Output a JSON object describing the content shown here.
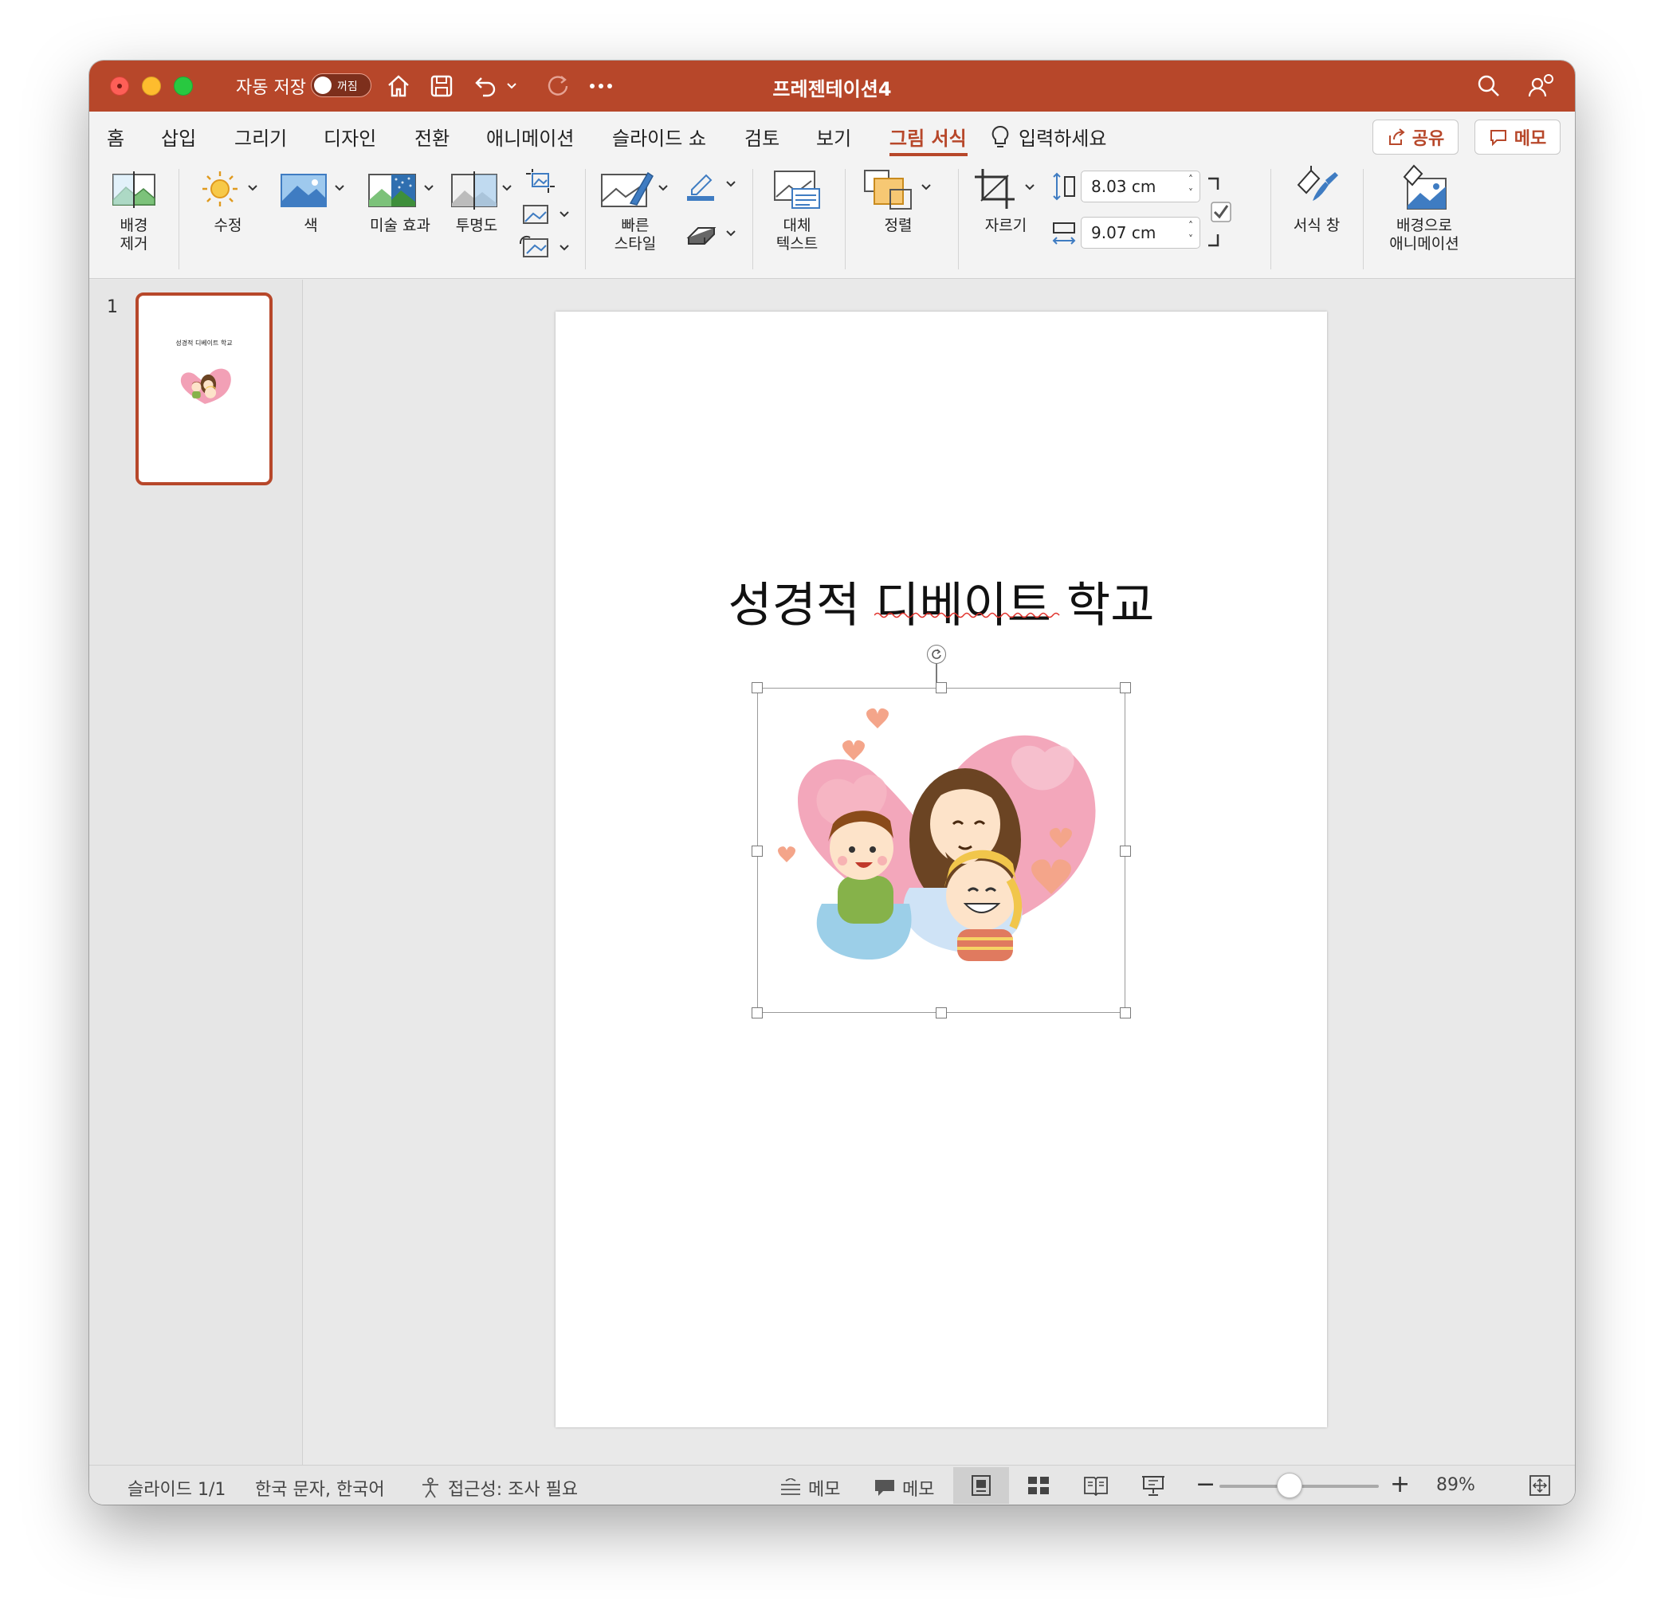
{
  "window": {
    "title": "프레젠테이션4",
    "autosave_label": "자동 저장",
    "autosave_state": "꺼짐"
  },
  "tabs": [
    {
      "label": "홈"
    },
    {
      "label": "삽입"
    },
    {
      "label": "그리기"
    },
    {
      "label": "디자인"
    },
    {
      "label": "전환"
    },
    {
      "label": "애니메이션"
    },
    {
      "label": "슬라이드 쇼"
    },
    {
      "label": "검토"
    },
    {
      "label": "보기"
    },
    {
      "label": "그림 서식"
    }
  ],
  "active_tab": "그림 서식",
  "tell_me": "입력하세요",
  "share_label": "공유",
  "memo_label": "메모",
  "ribbon": {
    "remove_bg": {
      "line1": "배경",
      "line2": "제거"
    },
    "corrections": "수정",
    "color": "색",
    "artistic": "미술 효과",
    "transparency": "투명도",
    "quick_styles": {
      "line1": "빠른",
      "line2": "스타일"
    },
    "alt_text": {
      "line1": "대체",
      "line2": "텍스트"
    },
    "arrange": "정렬",
    "crop": "자르기",
    "height": "8.03 cm",
    "width": "9.07 cm",
    "format_pane": "서식 창",
    "animate_bg": {
      "line1": "배경으로",
      "line2": "애니메이션"
    }
  },
  "thumbnails": [
    {
      "number": "1",
      "title": "성경적 디베이트 학교"
    }
  ],
  "slide": {
    "title": "성경적 디베이트 학교"
  },
  "status": {
    "slide_pos": "슬라이드 1/1",
    "language": "한국 문자, 한국어",
    "accessibility": "접근성: 조사 필요",
    "notes": "메모",
    "comments": "메모",
    "zoom": "89%"
  },
  "colors": {
    "accent": "#b7472a",
    "toggle_bg": "#7d2f1c"
  }
}
